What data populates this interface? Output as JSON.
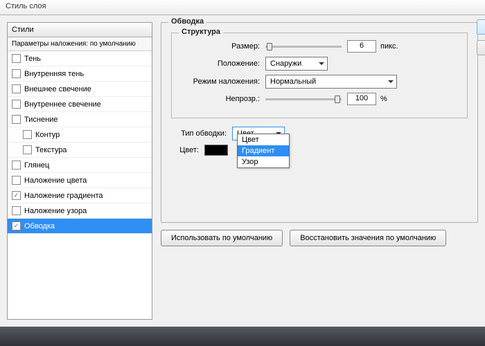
{
  "window": {
    "title": "Стиль слоя"
  },
  "left": {
    "header": "Стили",
    "sub": "Параметры наложения: по умолчанию",
    "effects": [
      {
        "label": "Тень",
        "checked": false,
        "selected": false,
        "indent": false
      },
      {
        "label": "Внутренняя тень",
        "checked": false,
        "selected": false,
        "indent": false
      },
      {
        "label": "Внешнее свечение",
        "checked": false,
        "selected": false,
        "indent": false
      },
      {
        "label": "Внутреннее свечение",
        "checked": false,
        "selected": false,
        "indent": false
      },
      {
        "label": "Тиснение",
        "checked": false,
        "selected": false,
        "indent": false
      },
      {
        "label": "Контур",
        "checked": false,
        "selected": false,
        "indent": true
      },
      {
        "label": "Текстура",
        "checked": false,
        "selected": false,
        "indent": true
      },
      {
        "label": "Глянец",
        "checked": false,
        "selected": false,
        "indent": false
      },
      {
        "label": "Наложение цвета",
        "checked": false,
        "selected": false,
        "indent": false
      },
      {
        "label": "Наложение градиента",
        "checked": true,
        "selected": false,
        "indent": false
      },
      {
        "label": "Наложение узора",
        "checked": false,
        "selected": false,
        "indent": false
      },
      {
        "label": "Обводка",
        "checked": true,
        "selected": true,
        "indent": false
      }
    ]
  },
  "stroke": {
    "group_title": "Обводка",
    "structure_title": "Структура",
    "size_label": "Размер:",
    "size_value": "6",
    "size_unit": "пикс.",
    "position_label": "Положение:",
    "position_value": "Снаружи",
    "blend_label": "Режим наложения:",
    "blend_value": "Нормальный",
    "opacity_label": "Непрозр.:",
    "opacity_value": "100",
    "opacity_unit": "%",
    "filltype_label": "Тип обводки:",
    "filltype_value": "Цвет",
    "filltype_options": [
      {
        "label": "Цвет",
        "selected": false
      },
      {
        "label": "Градиент",
        "selected": true
      },
      {
        "label": "Узор",
        "selected": false
      }
    ],
    "color_label": "Цвет:",
    "color_value": "#000000"
  },
  "buttons": {
    "default": "Использовать по умолчанию",
    "reset": "Восстановить значения по умолчанию"
  }
}
